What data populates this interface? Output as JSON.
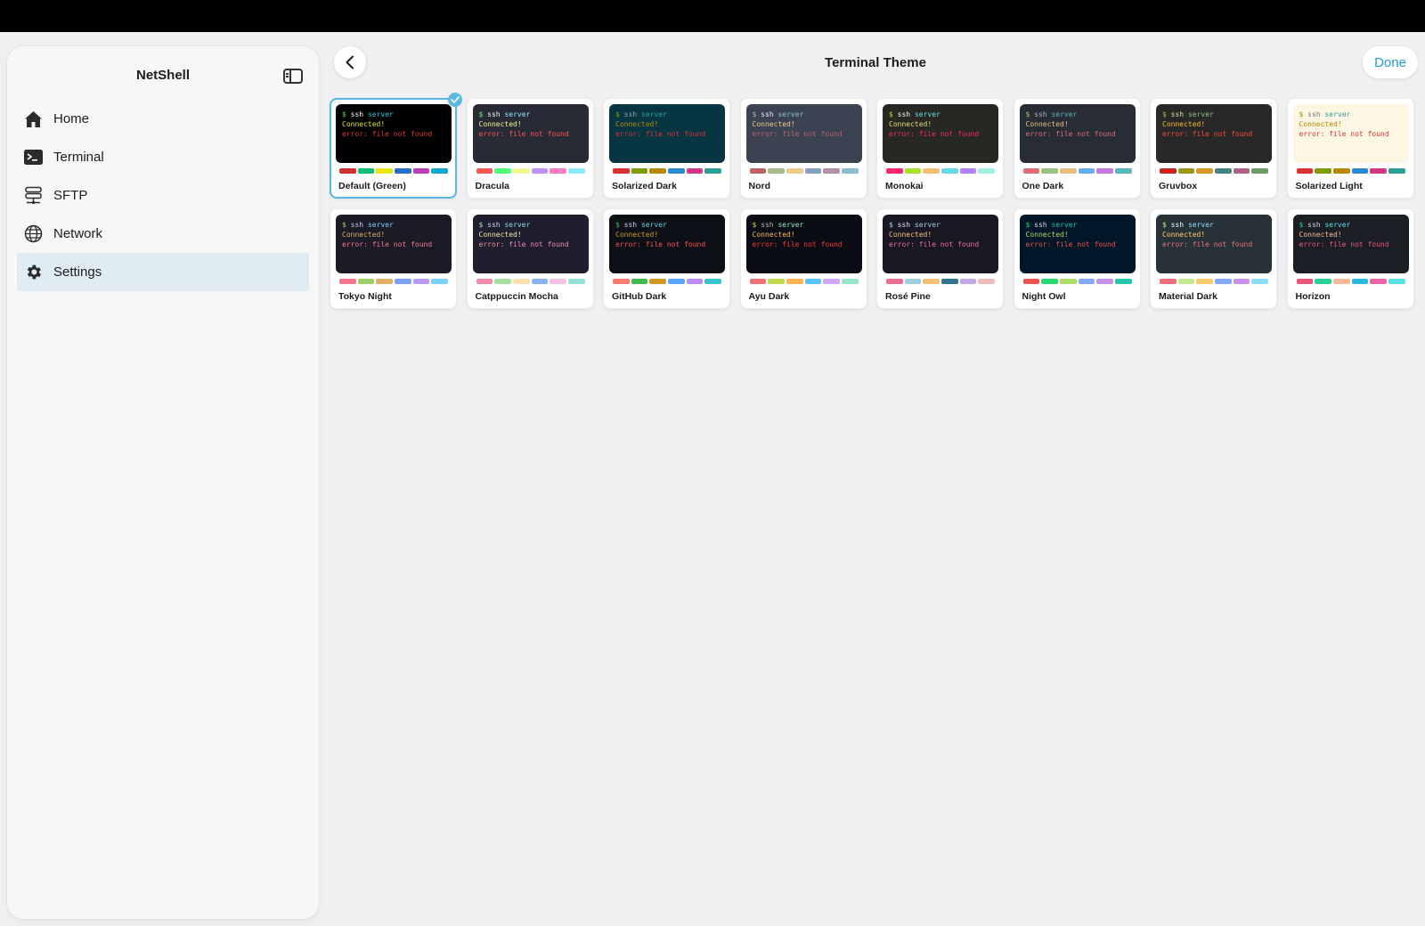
{
  "sidebar": {
    "title": "NetShell",
    "items": [
      {
        "label": "Home",
        "icon": "house-icon",
        "active": false
      },
      {
        "label": "Terminal",
        "icon": "terminal-icon",
        "active": false
      },
      {
        "label": "SFTP",
        "icon": "server-stack-icon",
        "active": false
      },
      {
        "label": "Network",
        "icon": "globe-icon",
        "active": false
      },
      {
        "label": "Settings",
        "icon": "gear-icon",
        "active": true
      }
    ]
  },
  "header": {
    "title": "Terminal Theme",
    "done_label": "Done"
  },
  "preview_text": {
    "prompt": "$",
    "command": "ssh",
    "argument": "server",
    "connected": "Connected!",
    "error": "error: file not found"
  },
  "selected_index": 0,
  "themes": [
    {
      "name": "Default (Green)",
      "bg": "#000000",
      "prompt": "#3ddc3d",
      "cmd": "#ffffff",
      "arg": "#2fc7d8",
      "ok": "#e5e510",
      "err": "#e53935",
      "swatches": [
        "#cd3131",
        "#0dbc79",
        "#e5e510",
        "#2472c8",
        "#bc3fbc",
        "#11a8cd"
      ]
    },
    {
      "name": "Dracula",
      "bg": "#282a36",
      "prompt": "#50fa7b",
      "cmd": "#f8f8f2",
      "arg": "#8be9fd",
      "ok": "#f1fa8c",
      "err": "#ff5555",
      "swatches": [
        "#ff5555",
        "#50fa7b",
        "#f1fa8c",
        "#bd93f9",
        "#ff79c6",
        "#8be9fd"
      ]
    },
    {
      "name": "Solarized Dark",
      "bg": "#073642",
      "prompt": "#859900",
      "cmd": "#93a1a1",
      "arg": "#2aa198",
      "ok": "#b58900",
      "err": "#dc322f",
      "swatches": [
        "#dc322f",
        "#859900",
        "#b58900",
        "#268bd2",
        "#d33682",
        "#2aa198"
      ]
    },
    {
      "name": "Nord",
      "bg": "#3b4252",
      "prompt": "#a3be8c",
      "cmd": "#eceff4",
      "arg": "#88c0d0",
      "ok": "#ebcb8b",
      "err": "#bf616a",
      "swatches": [
        "#bf616a",
        "#a3be8c",
        "#ebcb8b",
        "#81a1c1",
        "#b48ead",
        "#88c0d0"
      ]
    },
    {
      "name": "Monokai",
      "bg": "#272822",
      "prompt": "#a6e22e",
      "cmd": "#f8f8f2",
      "arg": "#66d9ef",
      "ok": "#e6db74",
      "err": "#f92672",
      "swatches": [
        "#f92672",
        "#a6e22e",
        "#f4bf75",
        "#66d9ef",
        "#ae81ff",
        "#a1efe4"
      ]
    },
    {
      "name": "One Dark",
      "bg": "#282c34",
      "prompt": "#98c379",
      "cmd": "#abb2bf",
      "arg": "#56b6c2",
      "ok": "#e5c07b",
      "err": "#e06c75",
      "swatches": [
        "#e06c75",
        "#98c379",
        "#e5c07b",
        "#61afef",
        "#c678dd",
        "#56b6c2"
      ]
    },
    {
      "name": "Gruvbox",
      "bg": "#282828",
      "prompt": "#b8bb26",
      "cmd": "#ebdbb2",
      "arg": "#8ec07c",
      "ok": "#fabd2f",
      "err": "#fb4934",
      "swatches": [
        "#cc241d",
        "#98971a",
        "#d79921",
        "#458588",
        "#b16286",
        "#689d6a"
      ]
    },
    {
      "name": "Solarized Light",
      "bg": "#fdf6e3",
      "prompt": "#859900",
      "cmd": "#657b83",
      "arg": "#2aa198",
      "ok": "#b58900",
      "err": "#dc322f",
      "swatches": [
        "#dc322f",
        "#859900",
        "#b58900",
        "#268bd2",
        "#d33682",
        "#2aa198"
      ]
    },
    {
      "name": "Tokyo Night",
      "bg": "#1a1b26",
      "prompt": "#9ece6a",
      "cmd": "#c0caf5",
      "arg": "#7dcfff",
      "ok": "#e0af68",
      "err": "#f7768e",
      "swatches": [
        "#f7768e",
        "#9ece6a",
        "#e0af68",
        "#7aa2f7",
        "#bb9af7",
        "#7dcfff"
      ]
    },
    {
      "name": "Catppuccin Mocha",
      "bg": "#1e1e2e",
      "prompt": "#a6e3a1",
      "cmd": "#cdd6f4",
      "arg": "#89dceb",
      "ok": "#f9e2af",
      "err": "#f38ba8",
      "swatches": [
        "#f38ba8",
        "#a6e3a1",
        "#f9e2af",
        "#89b4fa",
        "#f5c2e7",
        "#94e2d5"
      ]
    },
    {
      "name": "GitHub Dark",
      "bg": "#0d1117",
      "prompt": "#3fb950",
      "cmd": "#c9d1d9",
      "arg": "#56d4dd",
      "ok": "#d29922",
      "err": "#f85149",
      "swatches": [
        "#ff7b72",
        "#3fb950",
        "#d29922",
        "#58a6ff",
        "#bc8cff",
        "#39c5cf"
      ]
    },
    {
      "name": "Ayu Dark",
      "bg": "#0a0e14",
      "prompt": "#c2d94c",
      "cmd": "#b3b1ad",
      "arg": "#95e6cb",
      "ok": "#ffb454",
      "err": "#ff3333",
      "swatches": [
        "#f07178",
        "#c2d94c",
        "#ffb454",
        "#59c2ff",
        "#d2a6ff",
        "#95e6cb"
      ]
    },
    {
      "name": "Rosé Pine",
      "bg": "#191724",
      "prompt": "#9ccfd8",
      "cmd": "#e0def4",
      "arg": "#9ccfd8",
      "ok": "#f6c177",
      "err": "#eb6f92",
      "swatches": [
        "#eb6f92",
        "#9ccfd8",
        "#f6c177",
        "#31748f",
        "#c4a7e7",
        "#ebbcba"
      ]
    },
    {
      "name": "Night Owl",
      "bg": "#011627",
      "prompt": "#22da6e",
      "cmd": "#d6deeb",
      "arg": "#21c7a8",
      "ok": "#addb67",
      "err": "#ef5350",
      "swatches": [
        "#ef5350",
        "#22da6e",
        "#addb67",
        "#82aaff",
        "#c792ea",
        "#21c7a8"
      ]
    },
    {
      "name": "Material Dark",
      "bg": "#263238",
      "prompt": "#c3e88d",
      "cmd": "#eeffff",
      "arg": "#89ddff",
      "ok": "#ffcb6b",
      "err": "#f07178",
      "swatches": [
        "#f07178",
        "#c3e88d",
        "#ffcb6b",
        "#82aaff",
        "#c792ea",
        "#89ddff"
      ]
    },
    {
      "name": "Horizon",
      "bg": "#1c1e26",
      "prompt": "#29d398",
      "cmd": "#d5d8da",
      "arg": "#59e1e3",
      "ok": "#fab795",
      "err": "#e95678",
      "swatches": [
        "#e95678",
        "#29d398",
        "#fab795",
        "#26bbd9",
        "#ee64ac",
        "#59e1e3"
      ]
    }
  ],
  "colors": {
    "accent": "#1e9bd7",
    "selected_border": "#5bb8e3",
    "sidebar_active": "#dfecf3"
  }
}
